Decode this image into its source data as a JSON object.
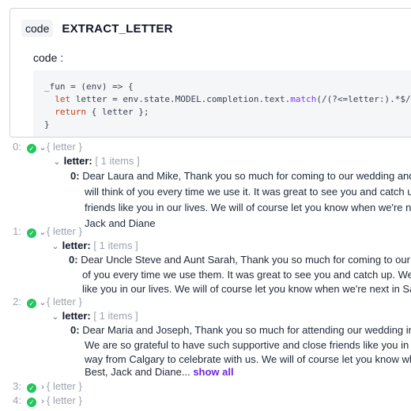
{
  "card": {
    "badge": "code",
    "title": "EXTRACT_LETTER",
    "code_label": "code :",
    "code_lines": [
      "_fun = (env) => {",
      "  let letter = env.state.MODEL.completion.text.match(/(?<=letter:).*$/);",
      "  return { letter };",
      "}"
    ]
  },
  "results": [
    {
      "index": "0:",
      "expanded": true,
      "summary": "{ letter }",
      "key": "letter:",
      "count": "[ 1 items ]",
      "item_index": "0:",
      "lines": [
        "Dear Laura and Mike, Thank you so much for coming to our wedding and",
        "will think of you every time we use it. It was great to see you and catch u",
        "friends like you in our lives. We will of course let you know when we're ne",
        "Jack and Diane"
      ]
    },
    {
      "index": "1:",
      "expanded": true,
      "summary": "{ letter }",
      "key": "letter:",
      "count": "[ 1 items ]",
      "item_index": "0:",
      "lines": [
        "Dear Uncle Steve and Aunt Sarah, Thank you so much for coming to our w",
        "of you every time we use them. It was great to see you and catch up. We",
        "like you in our lives. We will of course let you know when we're next in Sa"
      ]
    },
    {
      "index": "2:",
      "expanded": true,
      "summary": "{ letter }",
      "key": "letter:",
      "count": "[ 1 items ]",
      "item_index": "0:",
      "lines": [
        "Dear Maria and Joseph, Thank you so much for attending our wedding in",
        "We are so grateful to have such supportive and close friends like you in o",
        "way from Calgary to celebrate with us. We will of course let you know wh",
        "Best, Jack and Diane..."
      ],
      "show_all": "show all"
    },
    {
      "index": "3:",
      "expanded": false,
      "summary": "{ letter }"
    },
    {
      "index": "4:",
      "expanded": false,
      "summary": "{ letter }"
    }
  ],
  "icons": {
    "check": "check-circle-icon",
    "expanded": "chevron-down-icon",
    "collapsed": "chevron-right-icon"
  },
  "colors": {
    "check": "#22c55e",
    "show_all": "#6d28d9",
    "keyword": "#c2410c"
  }
}
